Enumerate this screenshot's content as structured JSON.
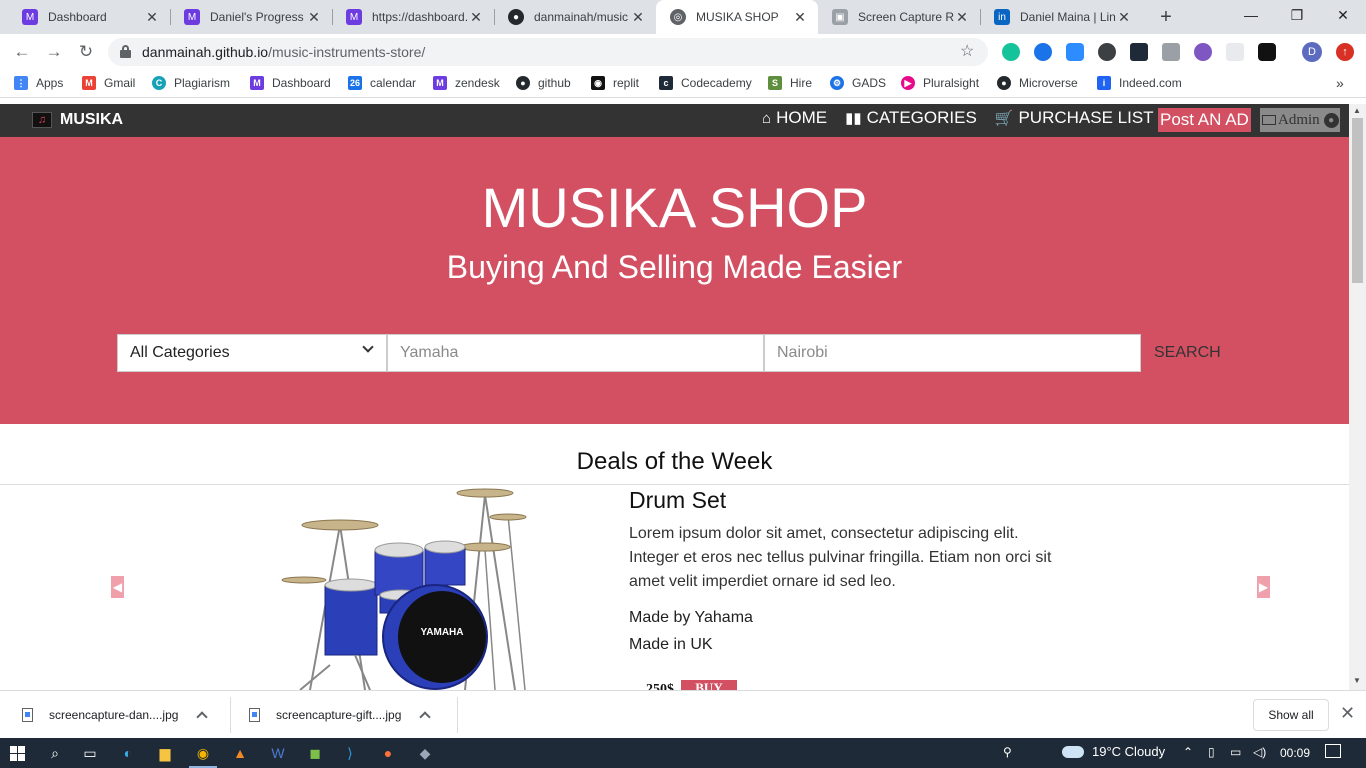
{
  "browser": {
    "tabs": [
      {
        "label": "Dashboard",
        "color": "#6c3ce1",
        "active": false
      },
      {
        "label": "Daniel's Progress",
        "color": "#6c3ce1",
        "active": false
      },
      {
        "label": "https://dashboard.",
        "color": "#6c3ce1",
        "active": false
      },
      {
        "label": "danmainah/music",
        "color": "#24292e",
        "active": false
      },
      {
        "label": "MUSIKA SHOP",
        "color": "#5f6368",
        "active": true
      },
      {
        "label": "Screen Capture Re",
        "color": "#9aa0a6",
        "active": false
      },
      {
        "label": "Daniel Maina | Link",
        "color": "#0a66c2",
        "active": false
      }
    ],
    "url_domain": "danmainah.github.io",
    "url_path": "/music-instruments-store/",
    "profile_initial": "D",
    "bookmarks": [
      {
        "label": "Apps",
        "icon": "apps-grid-icon",
        "color": "#4285f4"
      },
      {
        "label": "Gmail",
        "icon": "gmail-icon",
        "color": "#ea4335"
      },
      {
        "label": "Plagiarism",
        "icon": "plagiarism-icon",
        "color": "#17a2b8"
      },
      {
        "label": "Dashboard",
        "icon": "dashboard-icon",
        "color": "#6c3ce1"
      },
      {
        "label": "calendar",
        "icon": "calendar-icon",
        "color": "#1a73e8"
      },
      {
        "label": "zendesk",
        "icon": "zendesk-icon",
        "color": "#6c3ce1"
      },
      {
        "label": "github",
        "icon": "github-icon",
        "color": "#24292e"
      },
      {
        "label": "replit",
        "icon": "replit-icon",
        "color": "#111111"
      },
      {
        "label": "Codecademy",
        "icon": "codecademy-icon",
        "color": "#1f2a38"
      },
      {
        "label": "Hire",
        "icon": "shopify-icon",
        "color": "#5e8e3e"
      },
      {
        "label": "GADS",
        "icon": "gear-icon",
        "color": "#1a73e8"
      },
      {
        "label": "Pluralsight",
        "icon": "pluralsight-icon",
        "color": "#e80a89"
      },
      {
        "label": "Microverse",
        "icon": "github-icon",
        "color": "#24292e"
      },
      {
        "label": "Indeed.com",
        "icon": "indeed-icon",
        "color": "#2164f3"
      }
    ]
  },
  "site": {
    "brand": "MUSIKA",
    "nav": [
      {
        "label": "HOME",
        "icon": "home-icon"
      },
      {
        "label": "CATEGORIES",
        "icon": "columns-icon"
      },
      {
        "label": "PURCHASE LIST",
        "icon": "cart-icon"
      }
    ],
    "post_ad": "Post AN AD",
    "admin": "Admin",
    "accent": "#d35063"
  },
  "hero": {
    "title": "MUSIKA SHOP",
    "subtitle": "Buying And Selling Made Easier",
    "category_selected": "All Categories",
    "keyword_placeholder": "Yamaha",
    "location_placeholder": "Nairobi",
    "search_label": "SEARCH"
  },
  "deals": {
    "title": "Deals of the Week",
    "product": {
      "name": "Drum Set",
      "description": "Lorem ipsum dolor sit amet, consectetur adipiscing elit. Integer et eros nec tellus pulvinar fringilla. Etiam non orci sit amet velit imperdiet ornare id sed leo.",
      "maker": "Made by Yahama",
      "origin": "Made in UK",
      "price": "250$",
      "buy_label": "BUY",
      "drum_brand": "YAMAHA"
    }
  },
  "downloads": {
    "files": [
      "screencapture-dan....jpg",
      "screencapture-gift....jpg"
    ],
    "show_all": "Show all"
  },
  "taskbar": {
    "temperature": "19°C",
    "condition": "Cloudy",
    "time": "00:09"
  }
}
